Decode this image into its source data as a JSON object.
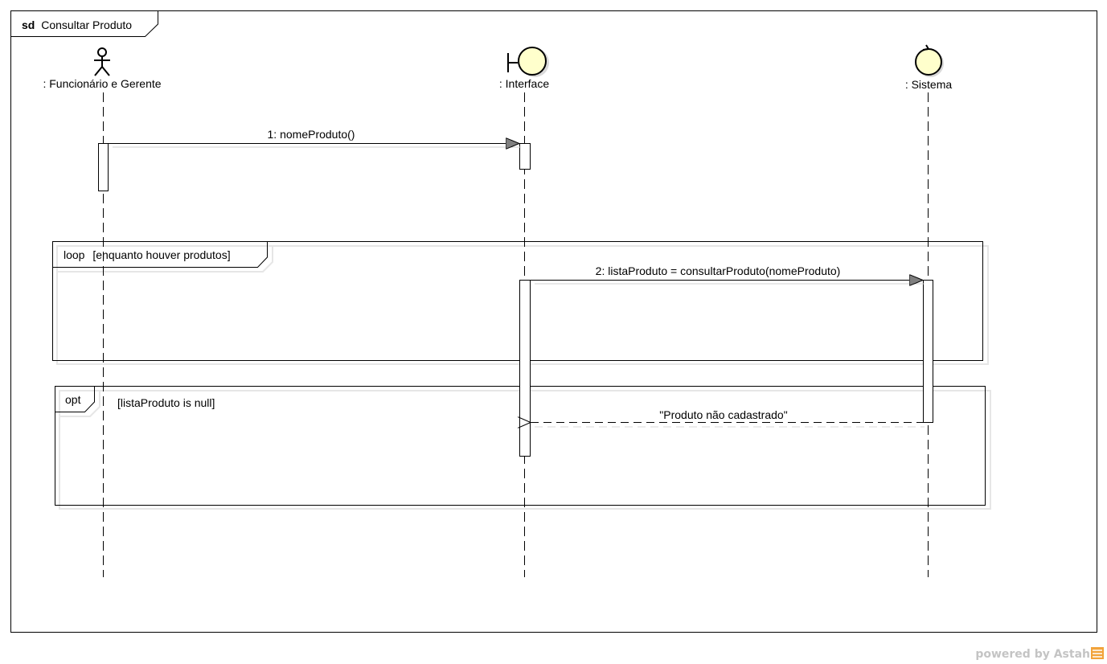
{
  "frame": {
    "keyword": "sd",
    "name": "Consultar Produto"
  },
  "lifelines": [
    {
      "id": "funcionario",
      "kind": "actor",
      "label": ": Funcionário e Gerente"
    },
    {
      "id": "interface",
      "kind": "boundary",
      "label": ": Interface"
    },
    {
      "id": "sistema",
      "kind": "control",
      "label": ": Sistema"
    }
  ],
  "messages": [
    {
      "number": "1",
      "label": "1: nomeProduto()",
      "from": "funcionario",
      "to": "interface",
      "type": "synchronous"
    },
    {
      "number": "2",
      "label": "2: listaProduto = consultarProduto(nomeProduto)",
      "from": "interface",
      "to": "sistema",
      "type": "synchronous"
    },
    {
      "number": "",
      "label": "\"Produto não cadastrado\"",
      "from": "sistema",
      "to": "interface",
      "type": "return"
    }
  ],
  "fragments": [
    {
      "operator": "loop",
      "guard": "[enquanto houver produtos]"
    },
    {
      "operator": "opt",
      "guard": "[listaProduto is null]"
    }
  ],
  "watermark": {
    "text": "powered by Astah",
    "accent_color": "#f2a33a"
  },
  "colors": {
    "lifeline_head_fill": "#ffffcc",
    "activation_fill": "#ffffff",
    "line": "#000000",
    "shadow": "#d9d9d9"
  }
}
